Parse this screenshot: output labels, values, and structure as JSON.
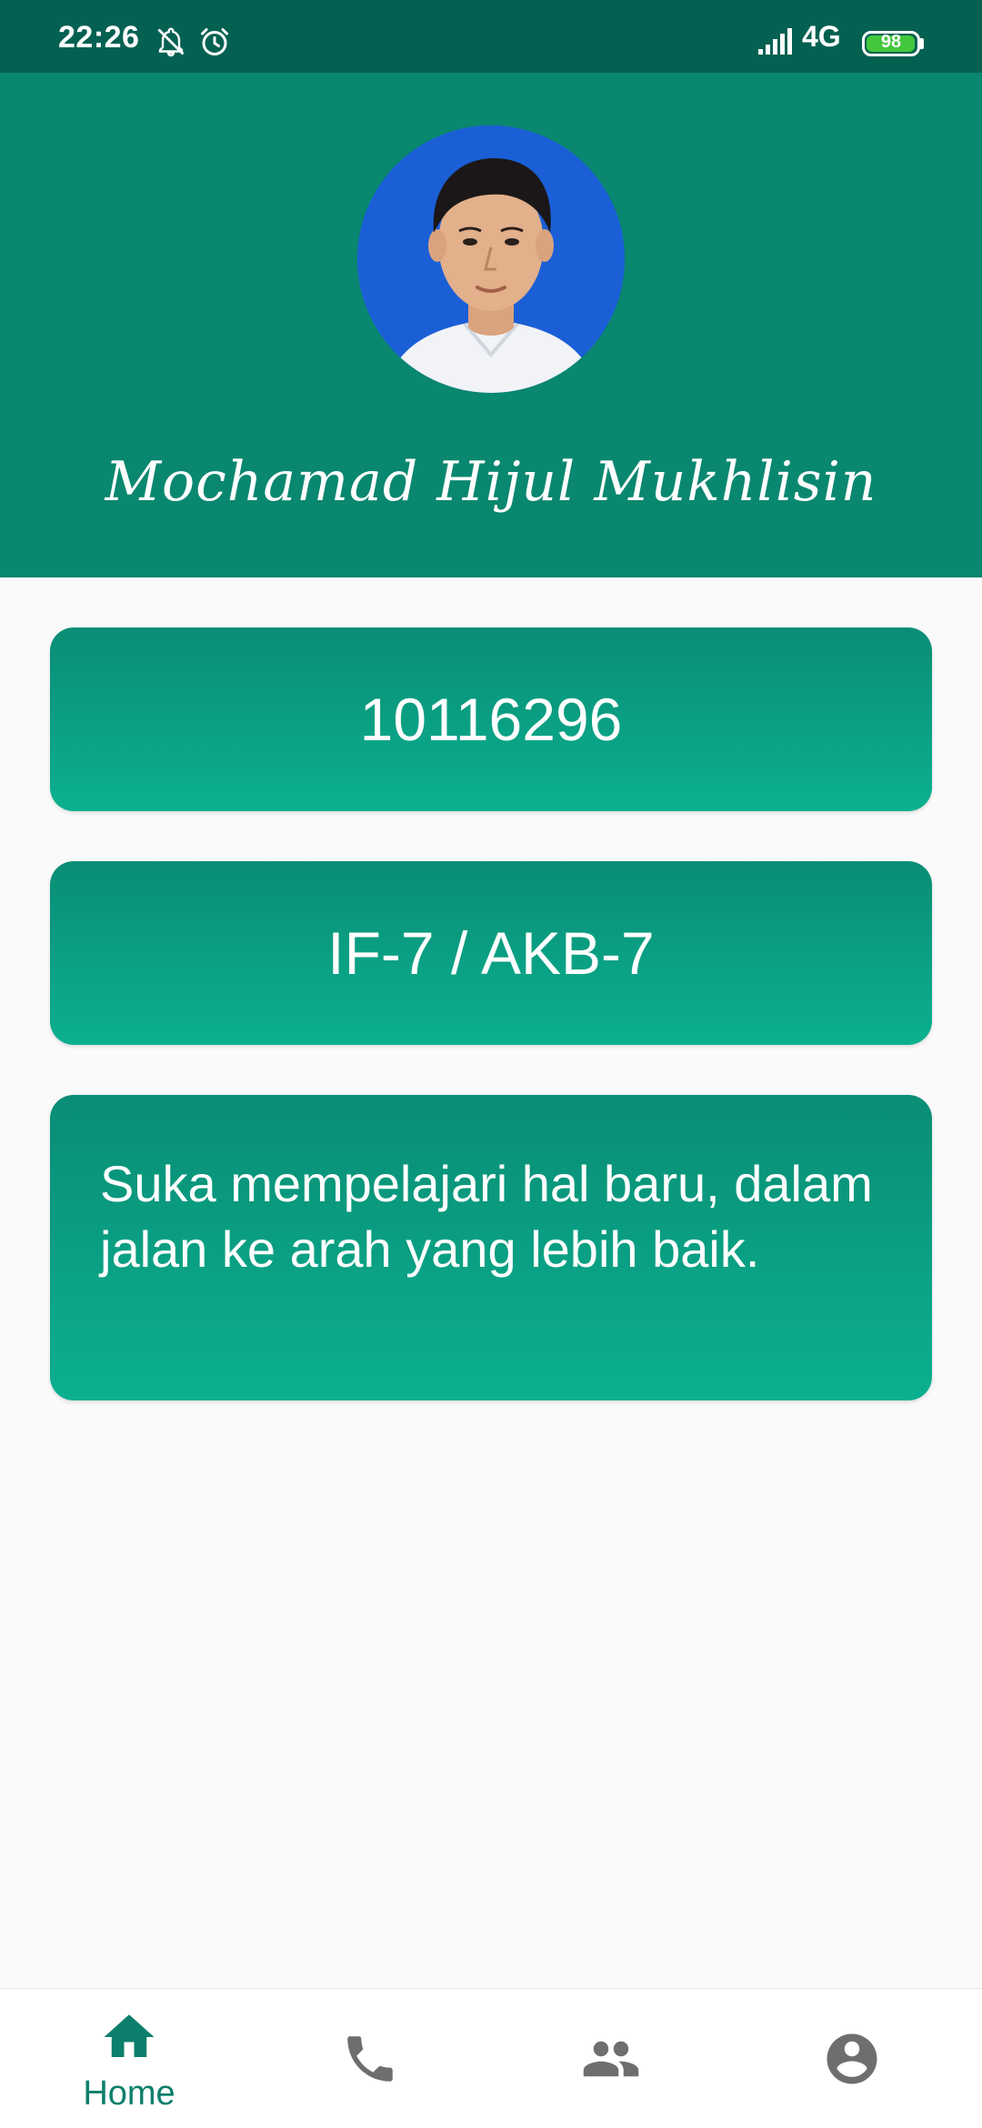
{
  "status_bar": {
    "time": "22:26",
    "network": "4G",
    "battery_level": "98",
    "battery_fraction": 0.98,
    "icons": [
      "bell-off-icon",
      "alarm-icon",
      "signal-icon",
      "battery-icon"
    ]
  },
  "profile": {
    "name": "Mochamad Hijul Mukhlisin",
    "avatar_icon": "profile-photo"
  },
  "cards": {
    "nim": "10116296",
    "class": "IF-7 / AKB-7",
    "description": "Suka mempelajari hal baru, dalam jalan ke arah yang lebih baik."
  },
  "bottom_nav": {
    "items": [
      {
        "label": "Home",
        "icon": "home-icon",
        "active": true
      },
      {
        "label": "",
        "icon": "phone-icon",
        "active": false
      },
      {
        "label": "",
        "icon": "people-icon",
        "active": false
      },
      {
        "label": "",
        "icon": "account-circle-icon",
        "active": false
      }
    ]
  },
  "colors": {
    "status_bar": "#046152",
    "header": "#0a876f",
    "card_top": "#0a8d75",
    "card_bottom": "#0bb08f",
    "nav_active": "#0b7f6c",
    "nav_inactive": "#6e6e6e",
    "background": "#fafafa"
  }
}
